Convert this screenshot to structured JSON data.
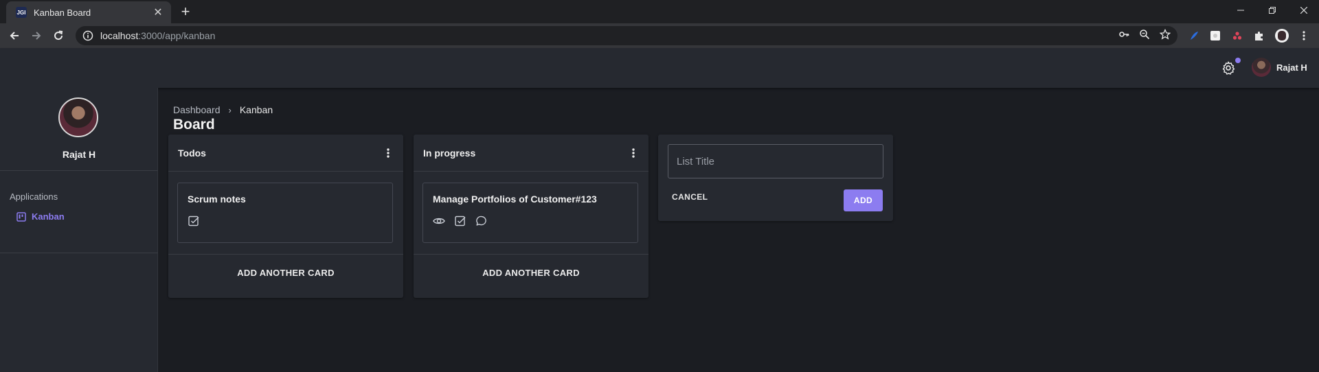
{
  "browser": {
    "tab": {
      "title": "Kanban Board",
      "favicon_text": "JGI",
      "close": "✕"
    },
    "new_tab": "+",
    "url": {
      "host": "localhost",
      "path": ":3000/app/kanban"
    }
  },
  "topbar": {
    "user_name": "Rajat H"
  },
  "sidebar": {
    "user_name": "Rajat H",
    "section": "Applications",
    "items": [
      {
        "label": "Kanban"
      }
    ]
  },
  "breadcrumb": {
    "items": [
      "Dashboard",
      "Kanban"
    ],
    "separator": "›"
  },
  "page": {
    "title": "Board"
  },
  "lists": [
    {
      "title": "Todos",
      "cards": [
        {
          "title": "Scrum notes",
          "icons": [
            "checkbox-icon"
          ]
        }
      ],
      "add_card": "ADD ANOTHER CARD"
    },
    {
      "title": "In progress",
      "cards": [
        {
          "title": "Manage Portfolios of Customer#123",
          "icons": [
            "eye-icon",
            "checkbox-icon",
            "comment-icon"
          ]
        }
      ],
      "add_card": "ADD ANOTHER CARD"
    }
  ],
  "new_list": {
    "placeholder": "List Title",
    "value": "",
    "cancel": "CANCEL",
    "add": "ADD"
  },
  "colors": {
    "accent": "#8c7cf0",
    "background": "#1b1d22",
    "surface": "#262930"
  }
}
